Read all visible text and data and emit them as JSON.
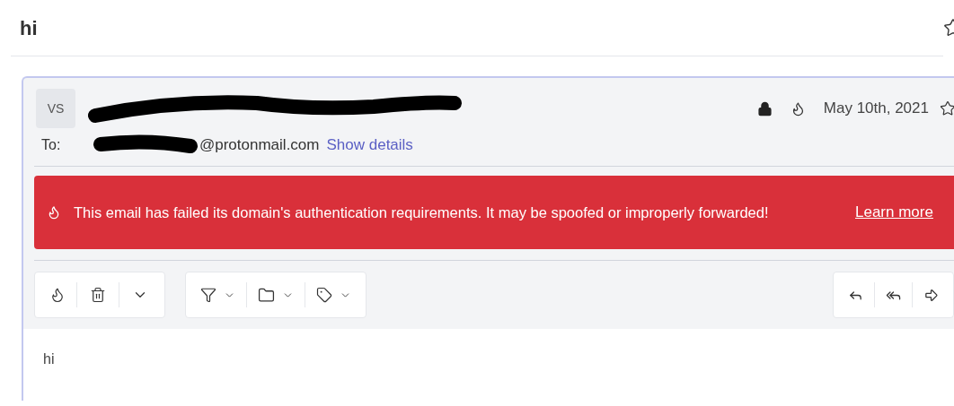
{
  "subject": "hi",
  "message": {
    "avatar": "VS",
    "date": "May 10th, 2021",
    "to_label": "To:",
    "to_visible": "@protonmail.com",
    "show_details": "Show details"
  },
  "banner": {
    "text": "This email has failed its domain's authentication requirements. It may be spoofed or improperly forwarded!",
    "link": "Learn more"
  },
  "body": "hi"
}
